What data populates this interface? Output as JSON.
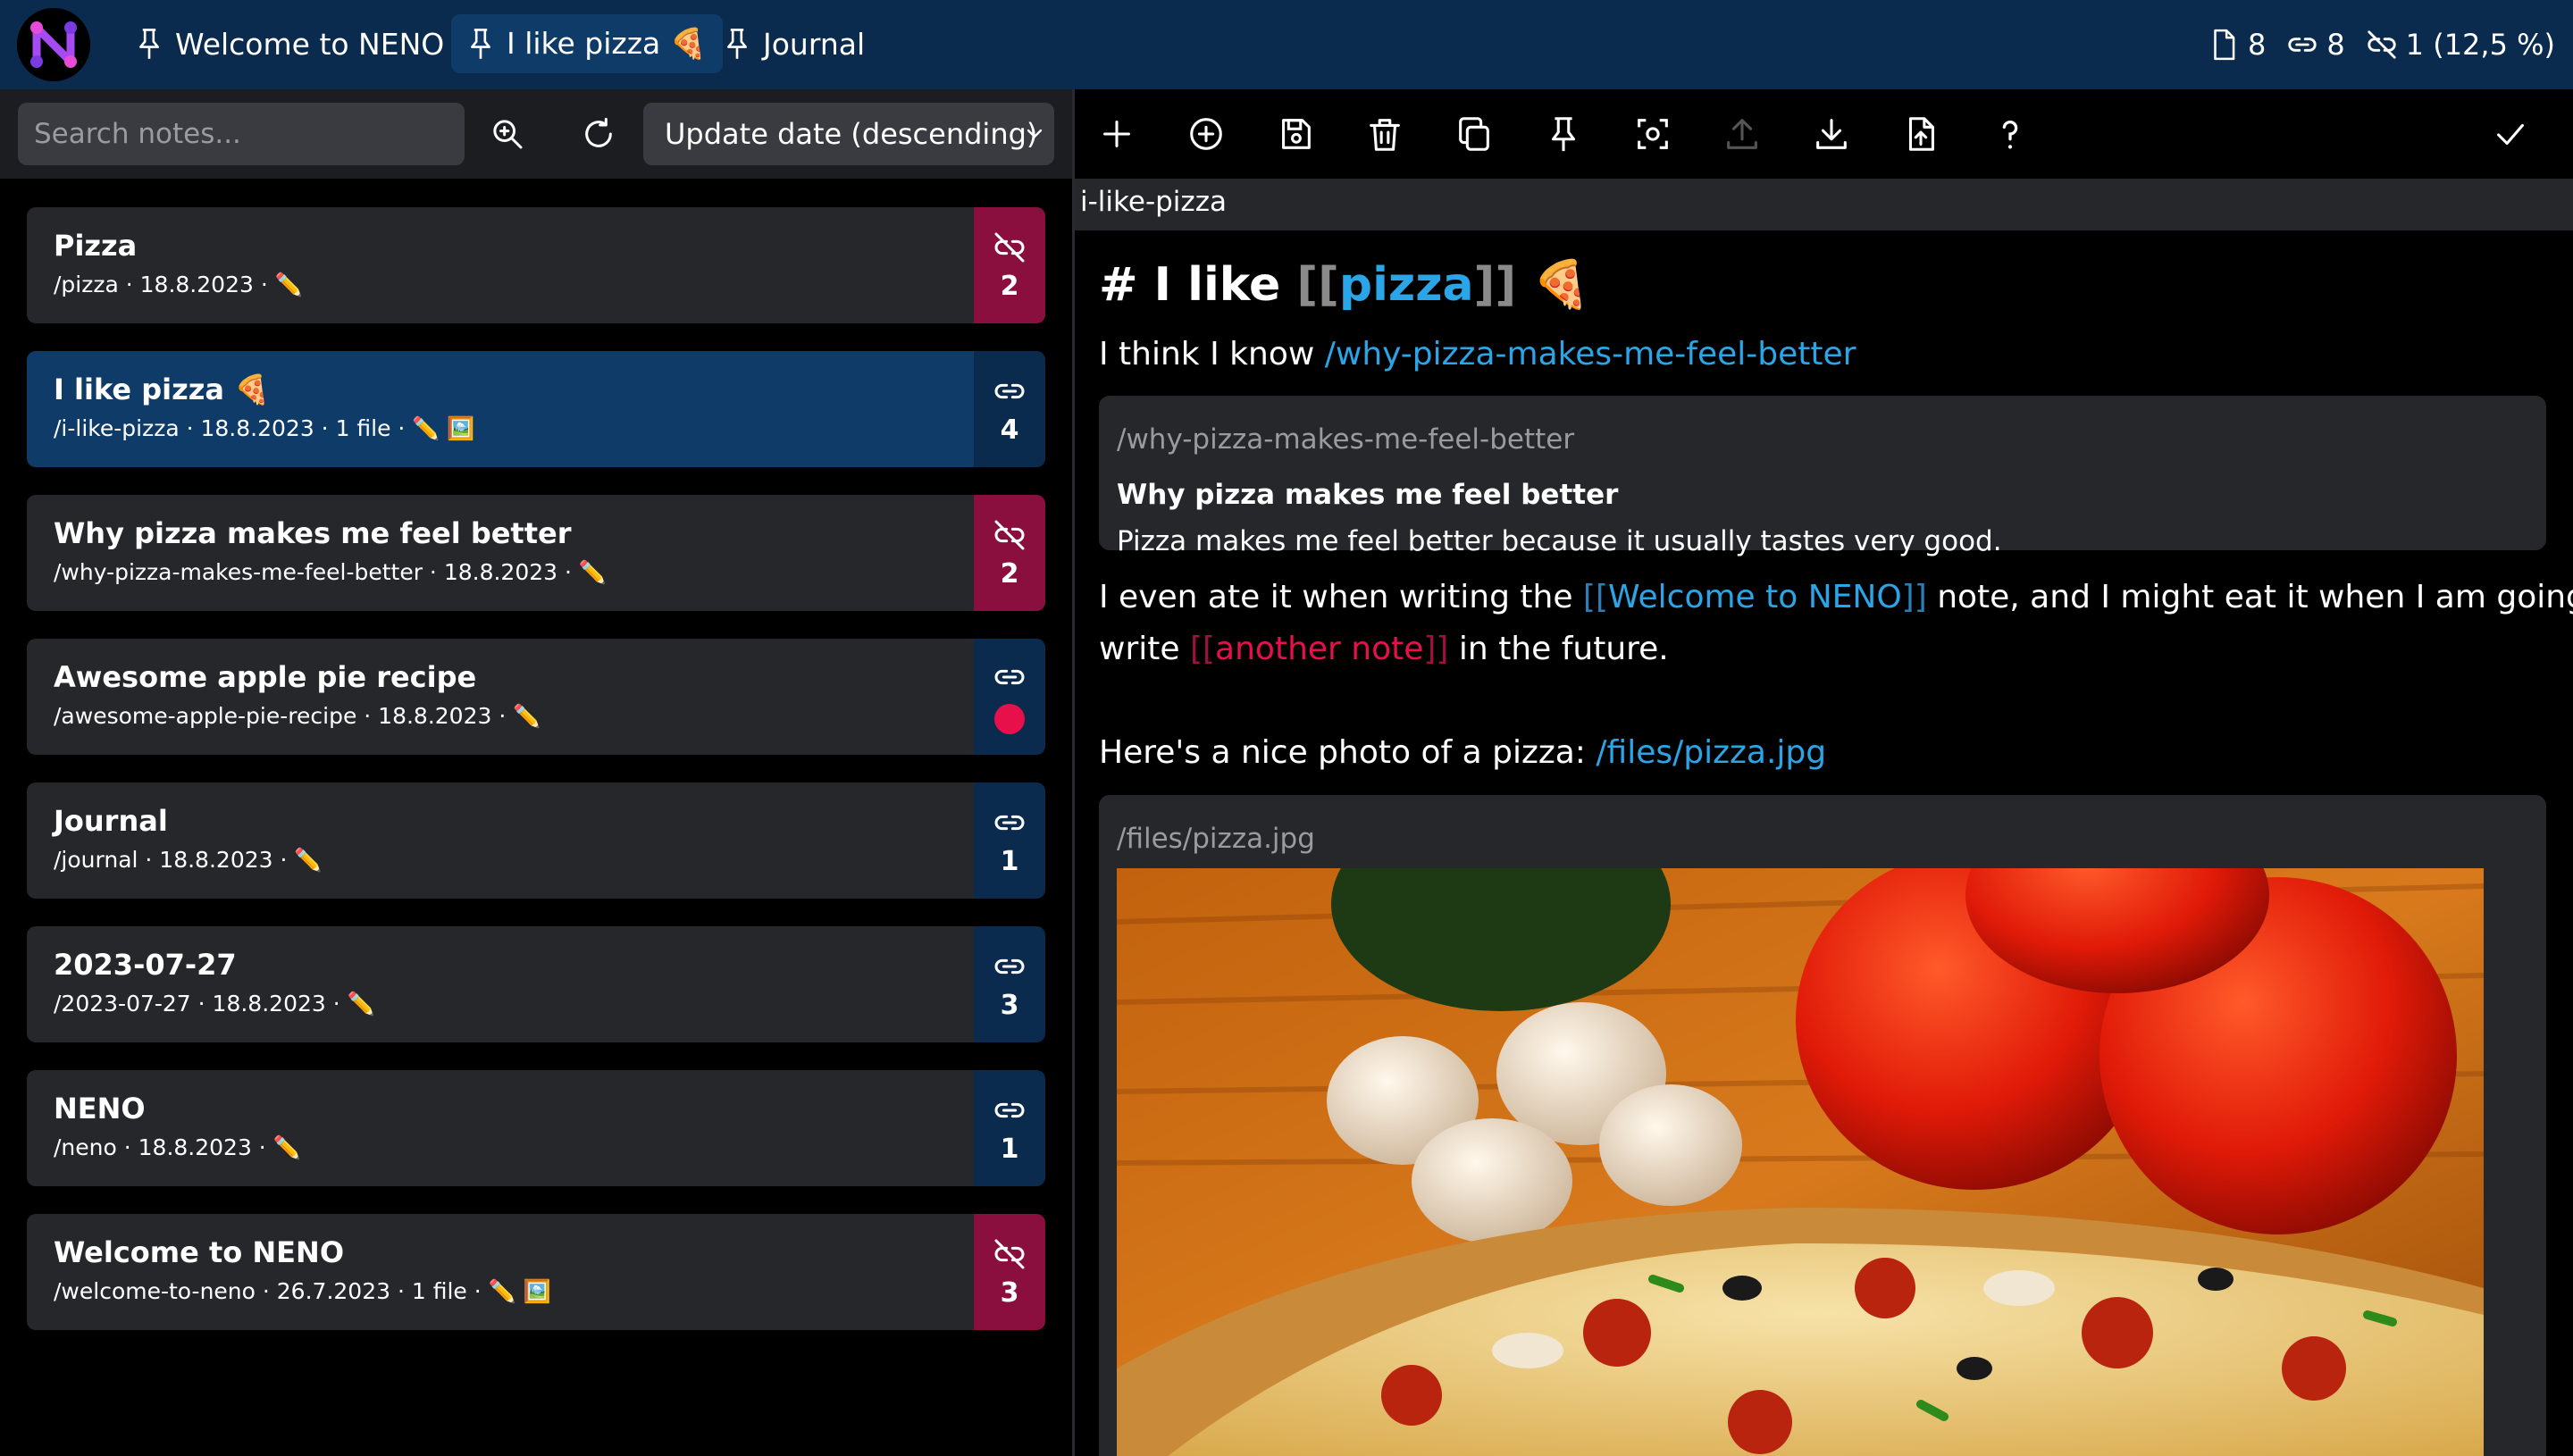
{
  "app": {
    "logo_letter": "N",
    "accent": "#0a2a4e",
    "active_tab_bg": "#0f3b68",
    "unlinked_color": "#8a0f3e",
    "link_color": "#2aa6e8",
    "warning_red": "#e8104b"
  },
  "pinned_tabs": [
    {
      "label": "Welcome to NENO",
      "icon": "pin-icon"
    },
    {
      "label": "I like pizza 🍕",
      "icon": "pin-icon"
    },
    {
      "label": "Journal",
      "icon": "pin-icon"
    }
  ],
  "stats": {
    "notes": "8",
    "links": "8",
    "unlinked": "1 (12,5 %)"
  },
  "search": {
    "placeholder": "Search notes...",
    "sort_label": "Update date (descending)"
  },
  "notes": [
    {
      "title": "Pizza",
      "meta": "/pizza · 18.8.2023 · ✏️",
      "count": "2",
      "linked": false
    },
    {
      "title": "I like pizza 🍕",
      "meta": "/i-like-pizza · 18.8.2023 · 1 file · ✏️ 🖼️",
      "count": "4",
      "linked": true,
      "active": true
    },
    {
      "title": "Why pizza makes me feel better",
      "meta": "/why-pizza-makes-me-feel-better · 18.8.2023 · ✏️",
      "count": "2",
      "linked": false
    },
    {
      "title": "Awesome apple pie recipe",
      "meta": "/awesome-apple-pie-recipe · 18.8.2023 · ✏️",
      "count": "",
      "linked": true,
      "dot": true
    },
    {
      "title": "Journal",
      "meta": "/journal · 18.8.2023 · ✏️",
      "count": "1",
      "linked": true
    },
    {
      "title": "2023-07-27",
      "meta": "/2023-07-27 · 18.8.2023 · ✏️",
      "count": "3",
      "linked": true
    },
    {
      "title": "NENO",
      "meta": "/neno · 18.8.2023 · ✏️",
      "count": "1",
      "linked": true
    },
    {
      "title": "Welcome to NENO",
      "meta": "/welcome-to-neno · 26.7.2023 · 1 file · ✏️ 🖼️",
      "count": "3",
      "linked": false
    }
  ],
  "toolbar": [
    "plus-icon",
    "add-circle-icon",
    "save-icon",
    "trash-icon",
    "duplicate-icon",
    "pin-icon",
    "screenshot-icon",
    "upload-icon",
    "download-icon",
    "import-file-icon",
    "help-icon",
    "check-icon"
  ],
  "editor": {
    "slug": "i-like-pizza",
    "heading_prefix": "# I like ",
    "heading_open": "[[",
    "heading_link": "pizza",
    "heading_close": "]]",
    "heading_suffix": " 🍕",
    "line1_text": "I think I know ",
    "line1_link": "/why-pizza-makes-me-feel-better",
    "transclusion1": {
      "slug": "/why-pizza-makes-me-feel-better",
      "title": "Why pizza makes me feel better",
      "text": "Pizza makes me feel better because it usually tastes very good."
    },
    "para2_a": "I even ate it when writing the ",
    "para2_open1": "[[",
    "para2_link1": "Welcome to NENO",
    "para2_close1": "]]",
    "para2_b": " note, and I might eat it when I am going to",
    "para2_c": "write ",
    "para2_open2": "[[",
    "para2_link2": "another note",
    "para2_close2": "]]",
    "para2_d": " in the future.",
    "line3_text": "Here's a nice photo of a pizza: ",
    "line3_link": "/files/pizza.jpg",
    "transclusion2": {
      "slug": "/files/pizza.jpg"
    }
  }
}
